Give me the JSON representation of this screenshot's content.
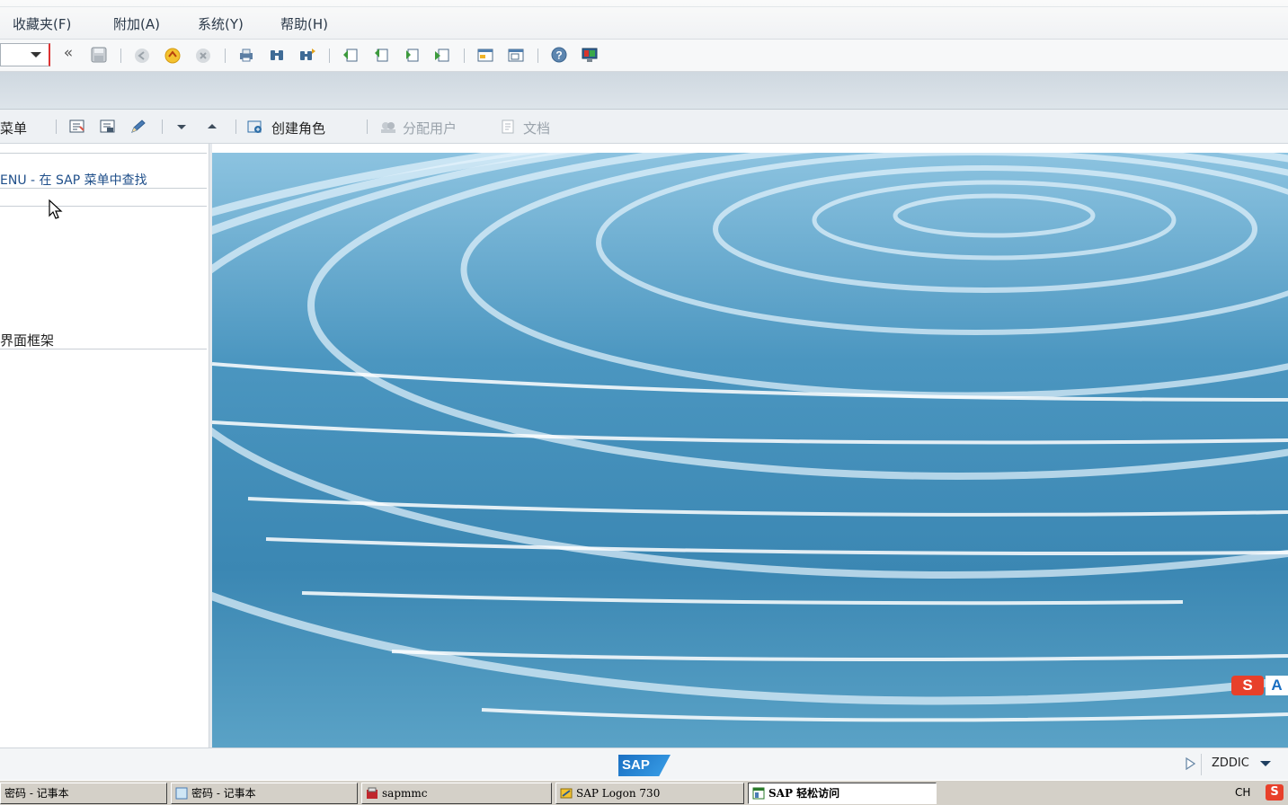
{
  "menubar": {
    "items": [
      {
        "label": "收藏夹(F)"
      },
      {
        "label": "附加(A)"
      },
      {
        "label": "系统(Y)"
      },
      {
        "label": "帮助(H)"
      }
    ]
  },
  "toolbar": {
    "back_glyph": "«",
    "icons": [
      "save-icon",
      "back-icon",
      "exit-icon",
      "cancel-icon",
      "print-icon",
      "find-icon",
      "find-next-icon",
      "first-page-icon",
      "previous-page-icon",
      "next-page-icon",
      "last-page-icon",
      "new-session-icon",
      "shortcut-icon",
      "help-icon",
      "layout-icon"
    ]
  },
  "app_toolbar": {
    "menu_label": "菜单",
    "create_role_label": "创建角色",
    "assign_users_label": "分配用户",
    "documentation_label": "文档"
  },
  "left_panel": {
    "search_row": "ENU - 在 SAP 菜单中查找",
    "frame_row": "界面框架"
  },
  "statusbar": {
    "logo_text": "SAP",
    "user": "ZDDIC"
  },
  "taskbar": {
    "items": [
      {
        "label": "密码 - 记事本",
        "active": false
      },
      {
        "label": "密码 - 记事本",
        "active": false
      },
      {
        "label": "sapmmc",
        "active": false
      },
      {
        "label": "SAP Logon 730",
        "active": false
      },
      {
        "label": "SAP 轻松访问",
        "active": true
      }
    ],
    "lang": "CH",
    "ime": "S"
  },
  "colors": {
    "water_top": "#7fb6d6",
    "water_mid": "#3a86b2",
    "sap_blue": "#1a6fc2"
  }
}
